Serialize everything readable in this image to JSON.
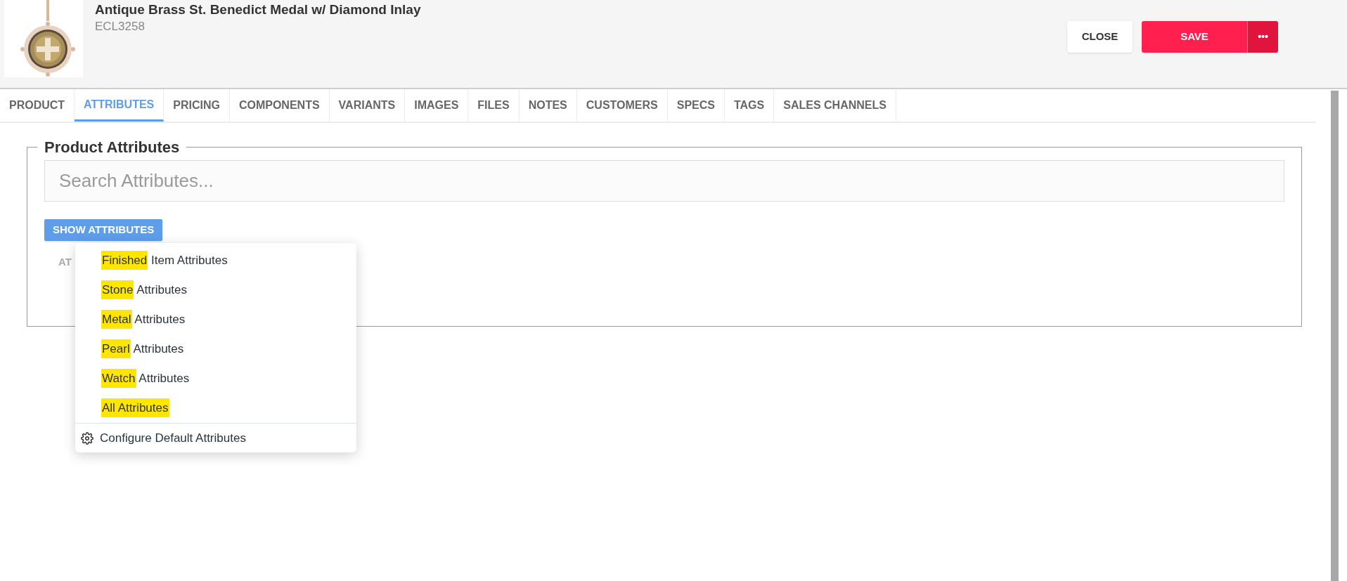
{
  "product": {
    "title": "Antique Brass St. Benedict Medal w/ Diamond Inlay",
    "code": "ECL3258"
  },
  "actions": {
    "close": "CLOSE",
    "save": "SAVE",
    "more": "•••"
  },
  "tabs": [
    {
      "label": "PRODUCT",
      "selected": false
    },
    {
      "label": "ATTRIBUTES",
      "selected": true
    },
    {
      "label": "PRICING",
      "selected": false
    },
    {
      "label": "COMPONENTS",
      "selected": false
    },
    {
      "label": "VARIANTS",
      "selected": false
    },
    {
      "label": "IMAGES",
      "selected": false
    },
    {
      "label": "FILES",
      "selected": false
    },
    {
      "label": "NOTES",
      "selected": false
    },
    {
      "label": "CUSTOMERS",
      "selected": false
    },
    {
      "label": "SPECS",
      "selected": false
    },
    {
      "label": "TAGS",
      "selected": false
    },
    {
      "label": "SALES CHANNELS",
      "selected": false
    }
  ],
  "section": {
    "title": "Product Attributes",
    "search": {
      "placeholder": "Search Attributes..."
    },
    "show_button": "SHOW ATTRIBUTES",
    "table": {
      "column_1": "AT"
    }
  },
  "menu": {
    "items": [
      {
        "highlighted": "Finished",
        "rest": " Item Attributes"
      },
      {
        "highlighted": "Stone",
        "rest": " Attributes"
      },
      {
        "highlighted": "Metal",
        "rest": " Attributes"
      },
      {
        "highlighted": "Pearl",
        "rest": " Attributes"
      },
      {
        "highlighted": "Watch",
        "rest": " Attributes"
      },
      {
        "highlighted": "All Attributes"
      }
    ],
    "footer": "Configure Default Attributes"
  }
}
